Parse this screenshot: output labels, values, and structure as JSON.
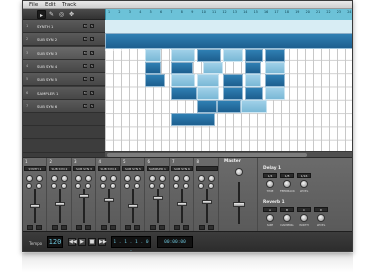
{
  "menu": {
    "items": [
      "File",
      "Edit",
      "Track"
    ]
  },
  "toolbar": {
    "tools": [
      "▸",
      "✎",
      "◎",
      "✥"
    ]
  },
  "ruler": {
    "numbers": [
      "1",
      "2",
      "3",
      "4",
      "5",
      "6",
      "7",
      "8",
      "9",
      "10",
      "11",
      "12",
      "13",
      "14",
      "15",
      "16",
      "17",
      "18",
      "19",
      "20",
      "21",
      "22",
      "23",
      "24",
      "25"
    ]
  },
  "tracks": [
    {
      "num": "1",
      "name": "SYNTH 1"
    },
    {
      "num": "2",
      "name": "SUB SYN 2"
    },
    {
      "num": "3",
      "name": "SUB SYN 3"
    },
    {
      "num": "4",
      "name": "SUB SYN 4"
    },
    {
      "num": "5",
      "name": "SUB SYN 5"
    },
    {
      "num": "6",
      "name": "SAMPLER 1"
    },
    {
      "num": "7",
      "name": "SUB SYN 6"
    }
  ],
  "track_buttons": {
    "mute": "M",
    "solo": "S"
  },
  "mixer": {
    "strips": [
      {
        "num": "1",
        "label": "SYNTH 1"
      },
      {
        "num": "2",
        "label": "SUB SYN 2"
      },
      {
        "num": "3",
        "label": "SUB SYN 3"
      },
      {
        "num": "4",
        "label": "SUB SYN 4"
      },
      {
        "num": "5",
        "label": "SUB SYN 5"
      },
      {
        "num": "6",
        "label": "SAMPLER 1"
      },
      {
        "num": "7",
        "label": "SUB SYN 6"
      },
      {
        "num": "8",
        "label": ""
      }
    ],
    "master_label": "Master"
  },
  "fx": {
    "delay": {
      "title": "Delay 1",
      "buttons": [
        "1/4",
        "1/8",
        "1/16"
      ],
      "knobs": [
        "TIME",
        "FEEDBACK",
        "LEVEL"
      ]
    },
    "reverb": {
      "title": "Reverb 1",
      "buttons": [
        "A",
        "B",
        "C",
        "D"
      ],
      "knobs": [
        "SIZE",
        "DAMPING",
        "WIDTH",
        "LEVEL"
      ]
    }
  },
  "transport": {
    "tempo_label": "Tempo",
    "tempo_value": "120",
    "position": "1 . 1 . 1 . 0 0",
    "time": "00:00:00",
    "buttons": [
      "◀◀",
      "▶",
      "■",
      "▶▶"
    ]
  },
  "colors": {
    "ruler": "#6cc2d8",
    "note_dark": "#1d5f8f",
    "note_light": "#7ab8d6"
  }
}
